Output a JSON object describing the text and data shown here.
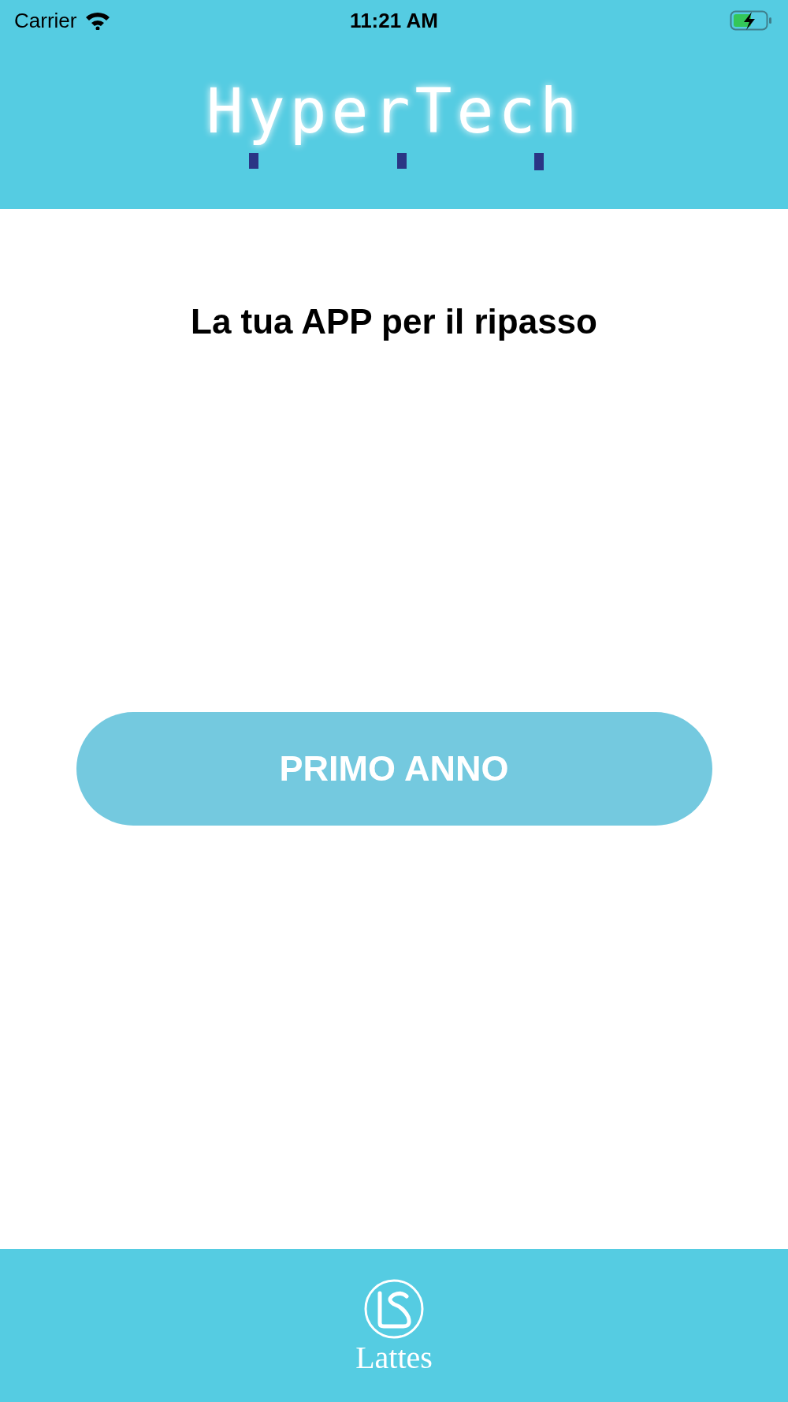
{
  "status_bar": {
    "carrier": "Carrier",
    "time": "11:21 AM",
    "charging": true
  },
  "header": {
    "logo": "HyperTech"
  },
  "title": "La tua APP per il ripasso",
  "buttons": [
    {
      "label": "PRIMO ANNO"
    }
  ],
  "footer": {
    "logo": "Lattes"
  }
}
